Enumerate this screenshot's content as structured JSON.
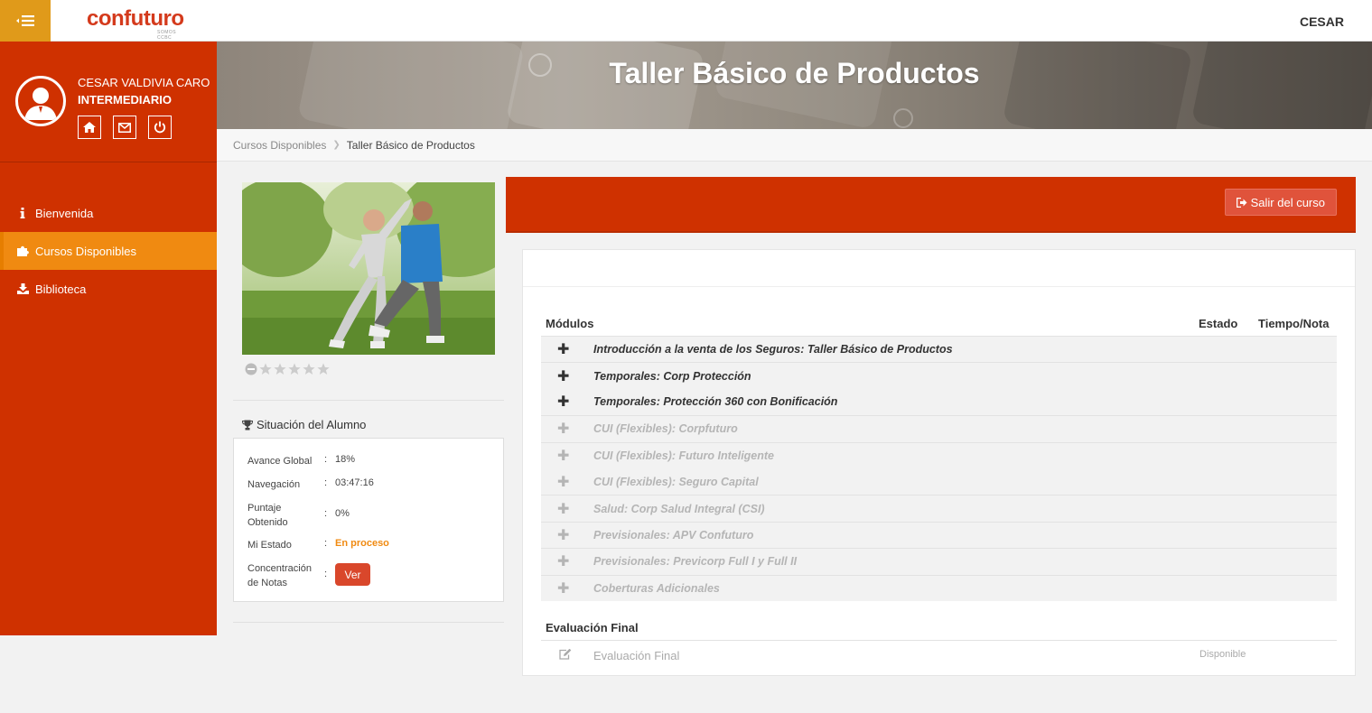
{
  "header": {
    "brand": "confuturo",
    "brand_sub": "SOMOS CCBC",
    "user": "CESAR"
  },
  "profile": {
    "name": "CESAR VALDIVIA CARO",
    "role": "INTERMEDIARIO"
  },
  "sidebar": {
    "items": [
      {
        "label": "Bienvenida",
        "icon": "info-icon",
        "active": false
      },
      {
        "label": "Cursos Disponibles",
        "icon": "puzzle-icon",
        "active": true
      },
      {
        "label": "Biblioteca",
        "icon": "download-icon",
        "active": false
      }
    ]
  },
  "banner": {
    "title": "Taller Básico de Productos"
  },
  "breadcrumb": {
    "items": [
      "Cursos Disponibles",
      "Taller Básico de Productos"
    ]
  },
  "course": {
    "rating": 0
  },
  "status": {
    "title": "Situación del Alumno",
    "rows": [
      {
        "label": "Avance Global",
        "value": "18%"
      },
      {
        "label": "Navegación",
        "value": "03:47:16"
      },
      {
        "label": "Puntaje Obtenido",
        "value": "0%"
      },
      {
        "label": "Mi Estado",
        "value": "En proceso"
      },
      {
        "label": "Concentración de Notas",
        "value": "Ver"
      }
    ]
  },
  "panel": {
    "exit_label": "Salir del curso"
  },
  "modules": {
    "headers": {
      "modules": "Módulos",
      "state": "Estado",
      "time": "Tiempo/Nota"
    },
    "rows": [
      {
        "label": "Introducción a la venta de los Seguros: Taller Básico de Productos",
        "enabled": true
      },
      {
        "label": "Temporales: Corp Protección",
        "enabled": true
      },
      {
        "label": "Temporales: Protección 360 con Bonificación",
        "enabled": true
      },
      {
        "label": "CUI (Flexibles): Corpfuturo",
        "enabled": false
      },
      {
        "label": "CUI (Flexibles): Futuro Inteligente",
        "enabled": false
      },
      {
        "label": "CUI (Flexibles): Seguro Capital",
        "enabled": false
      },
      {
        "label": "Salud: Corp Salud Integral (CSI)",
        "enabled": false
      },
      {
        "label": "Previsionales: APV Confuturo",
        "enabled": false
      },
      {
        "label": "Previsionales: Previcorp Full I y Full II",
        "enabled": false
      },
      {
        "label": "Coberturas Adicionales",
        "enabled": false
      }
    ]
  },
  "evaluation": {
    "title": "Evaluación Final",
    "item": "Evaluación Final",
    "status": "Disponible"
  },
  "colors": {
    "primary": "#cf3100",
    "accent": "#f08a11",
    "toggle": "#e09a1a",
    "button": "#d9472b"
  }
}
